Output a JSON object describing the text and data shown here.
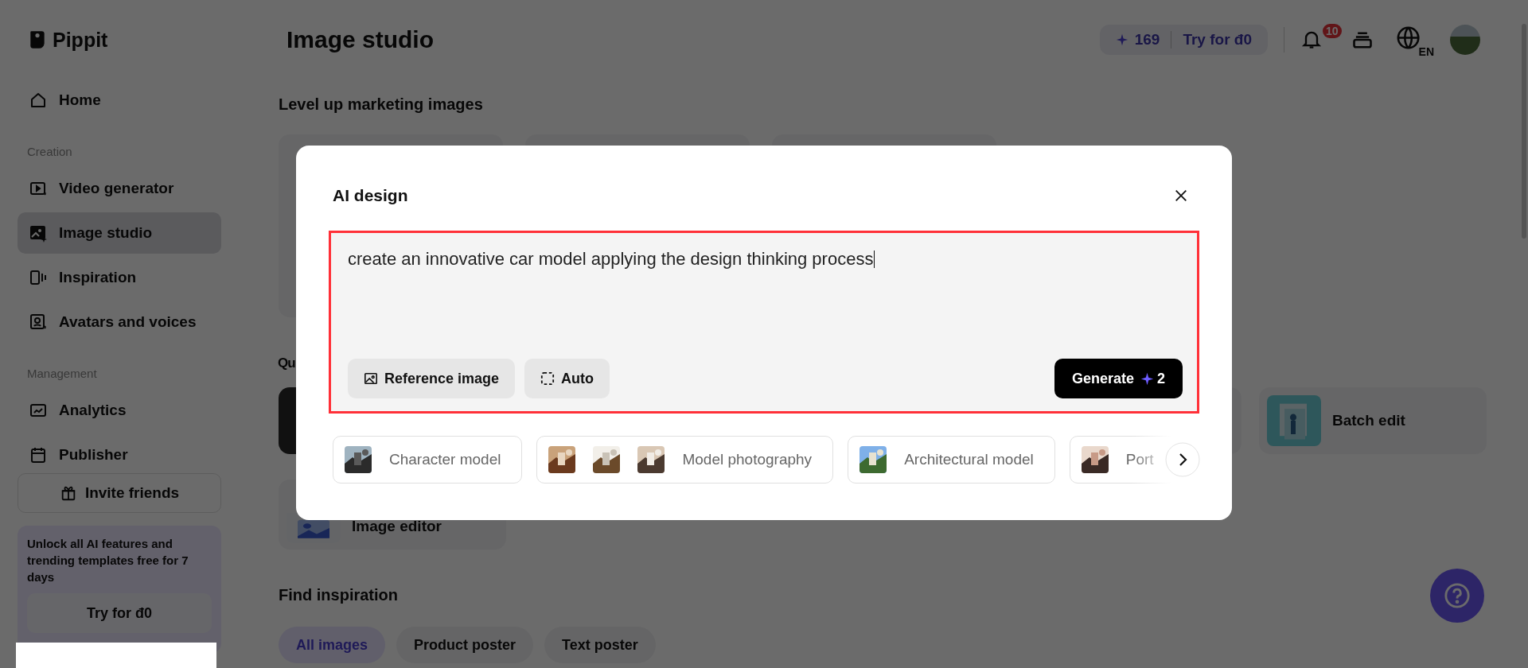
{
  "brand": {
    "name": "Pippit"
  },
  "sidebar": {
    "groups": [
      {
        "items": [
          {
            "label": "Home",
            "selected": false
          }
        ]
      },
      {
        "heading": "Creation",
        "items": [
          {
            "label": "Video generator",
            "selected": false
          },
          {
            "label": "Image studio",
            "selected": true
          },
          {
            "label": "Inspiration",
            "selected": false
          },
          {
            "label": "Avatars and voices",
            "selected": false
          }
        ]
      },
      {
        "heading": "Management",
        "items": [
          {
            "label": "Analytics",
            "selected": false
          },
          {
            "label": "Publisher",
            "selected": false
          }
        ]
      }
    ],
    "invite_button": "Invite friends",
    "promo": {
      "text": "Unlock all AI features and trending templates free for 7 days",
      "button": "Try for đ0"
    }
  },
  "header": {
    "title": "Image studio",
    "credits": "169",
    "try_label": "Try for đ0",
    "notification_count": "10",
    "language": "EN"
  },
  "main": {
    "level_up_heading": "Level up marketing images",
    "quick_heading": "Qu",
    "batch_edit": "Batch edit",
    "image_editor": "Image editor",
    "find_heading": "Find inspiration",
    "filters": [
      {
        "label": "All images",
        "selected": true
      },
      {
        "label": "Product poster",
        "selected": false
      },
      {
        "label": "Text poster",
        "selected": false
      }
    ]
  },
  "modal": {
    "title": "AI design",
    "prompt": {
      "value": "create an innovative car model applying the design thinking process",
      "highlighted": true
    },
    "reference_button": "Reference image",
    "auto_button": "Auto",
    "generate": {
      "label": "Generate",
      "cost": "2"
    },
    "chips": [
      {
        "label": "Character model"
      },
      {
        "label": "Model photography"
      },
      {
        "label": "Architectural model"
      },
      {
        "label": "Port"
      }
    ]
  }
}
